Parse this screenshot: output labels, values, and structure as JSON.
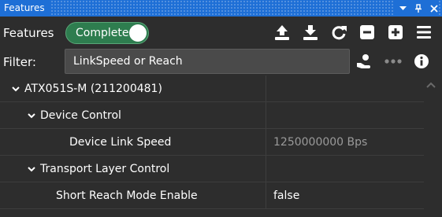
{
  "window": {
    "title": "Features"
  },
  "toolbar": {
    "features_label": "Features",
    "visibility_value": "Complete",
    "icons": [
      "upload-icon",
      "download-icon",
      "refresh-icon",
      "collapse-icon",
      "expand-icon",
      "menu-icon"
    ]
  },
  "filter": {
    "label": "Filter:",
    "value": "LinkSpeed or Reach",
    "icons": [
      "hand-icon",
      "more-icon",
      "info-icon"
    ]
  },
  "tree": {
    "device": "ATX051S-M (211200481)",
    "categories": [
      {
        "name": "Device Control",
        "features": [
          {
            "name": "Device Link Speed",
            "value": "1250000000 Bps",
            "readonly": true
          }
        ]
      },
      {
        "name": "Transport Layer Control",
        "features": [
          {
            "name": "Short Reach Mode Enable",
            "value": "false",
            "readonly": false
          }
        ]
      }
    ]
  },
  "colors": {
    "titlebar": "#1e6fd6",
    "background": "#2d2d2d",
    "switch_on": "#2e7d4f",
    "readonly_text": "#9a9a9a"
  }
}
